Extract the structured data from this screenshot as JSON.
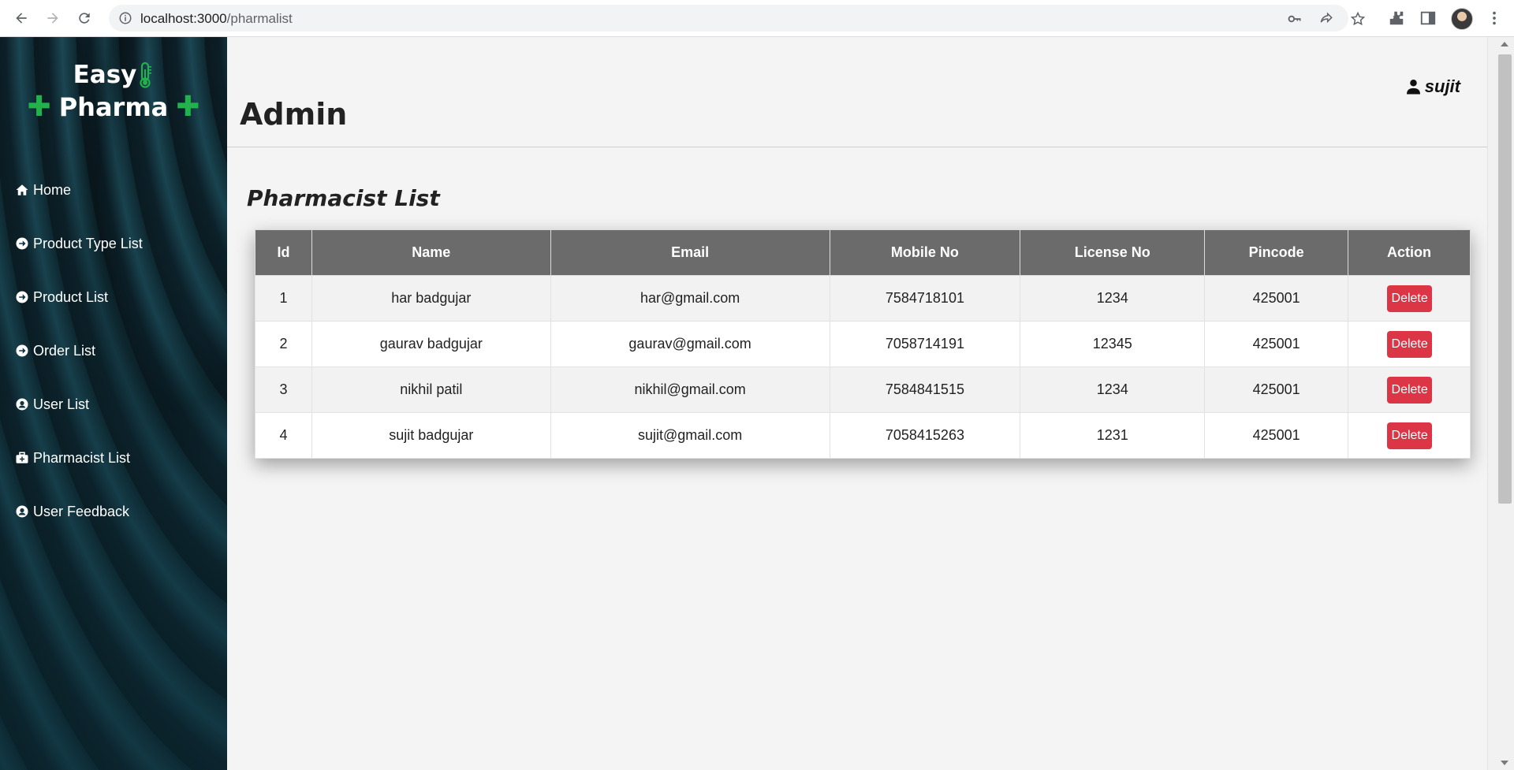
{
  "browser": {
    "url_host": "localhost:3000",
    "url_path": "/pharmalist"
  },
  "sidebar": {
    "logo": {
      "line1": "Easy",
      "line2": "Pharma"
    },
    "items": [
      {
        "label": "Home",
        "icon": "home-icon"
      },
      {
        "label": "Product Type List",
        "icon": "arrow-circle-right-icon"
      },
      {
        "label": "Product List",
        "icon": "arrow-circle-right-icon"
      },
      {
        "label": "Order List",
        "icon": "arrow-circle-right-icon"
      },
      {
        "label": "User List",
        "icon": "user-circle-icon"
      },
      {
        "label": "Pharmacist List",
        "icon": "medkit-icon"
      },
      {
        "label": "User Feedback",
        "icon": "user-circle-icon"
      }
    ]
  },
  "header": {
    "title": "Admin",
    "user": "sujit"
  },
  "main": {
    "section_title": "Pharmacist List",
    "table": {
      "columns": [
        "Id",
        "Name",
        "Email",
        "Mobile No",
        "License No",
        "Pincode",
        "Action"
      ],
      "rows": [
        {
          "id": "1",
          "name": "har badgujar",
          "email": "har@gmail.com",
          "mobile": "7584718101",
          "license": "1234",
          "pincode": "425001",
          "action": "Delete"
        },
        {
          "id": "2",
          "name": "gaurav badgujar",
          "email": "gaurav@gmail.com",
          "mobile": "7058714191",
          "license": "12345",
          "pincode": "425001",
          "action": "Delete"
        },
        {
          "id": "3",
          "name": "nikhil patil",
          "email": "nikhil@gmail.com",
          "mobile": "7584841515",
          "license": "1234",
          "pincode": "425001",
          "action": "Delete"
        },
        {
          "id": "4",
          "name": "sujit badgujar",
          "email": "sujit@gmail.com",
          "mobile": "7058415263",
          "license": "1231",
          "pincode": "425001",
          "action": "Delete"
        }
      ]
    }
  },
  "colors": {
    "header_row": "#6b6b6b",
    "delete_button": "#dc3545",
    "logo_plus": "#22b14c",
    "sidebar_bg": "#0f2a33"
  }
}
